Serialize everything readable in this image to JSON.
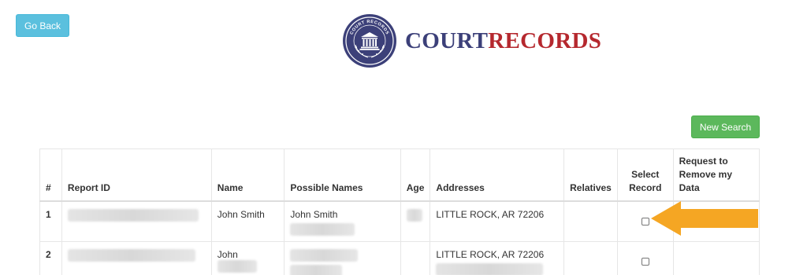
{
  "header": {
    "back_label": "Go Back",
    "logo_word1": "COURT",
    "logo_word2": "RECORDS",
    "seal_text": "COURT RECORDS"
  },
  "toolbar": {
    "new_search_label": "New Search"
  },
  "colors": {
    "back_button": "#5bc0de",
    "new_search_button": "#5cb85c",
    "logo_navy": "#3c4079",
    "logo_red": "#b5282e",
    "arrow": "#f5a623"
  },
  "table": {
    "headers": {
      "num": "#",
      "report_id": "Report ID",
      "name": "Name",
      "possible_names": "Possible Names",
      "age": "Age",
      "addresses": "Addresses",
      "relatives": "Relatives",
      "select_record": "Select Record",
      "request_remove": "Request to Remove my Data"
    },
    "rows": [
      {
        "num": "1",
        "name": "John Smith",
        "possible_name": "John Smith",
        "address": "LITTLE ROCK, AR 72206"
      },
      {
        "num": "2",
        "name": "John",
        "possible_name": "",
        "address": "LITTLE ROCK, AR 72206"
      }
    ]
  },
  "annotation": {
    "icon": "arrow-left-icon"
  }
}
